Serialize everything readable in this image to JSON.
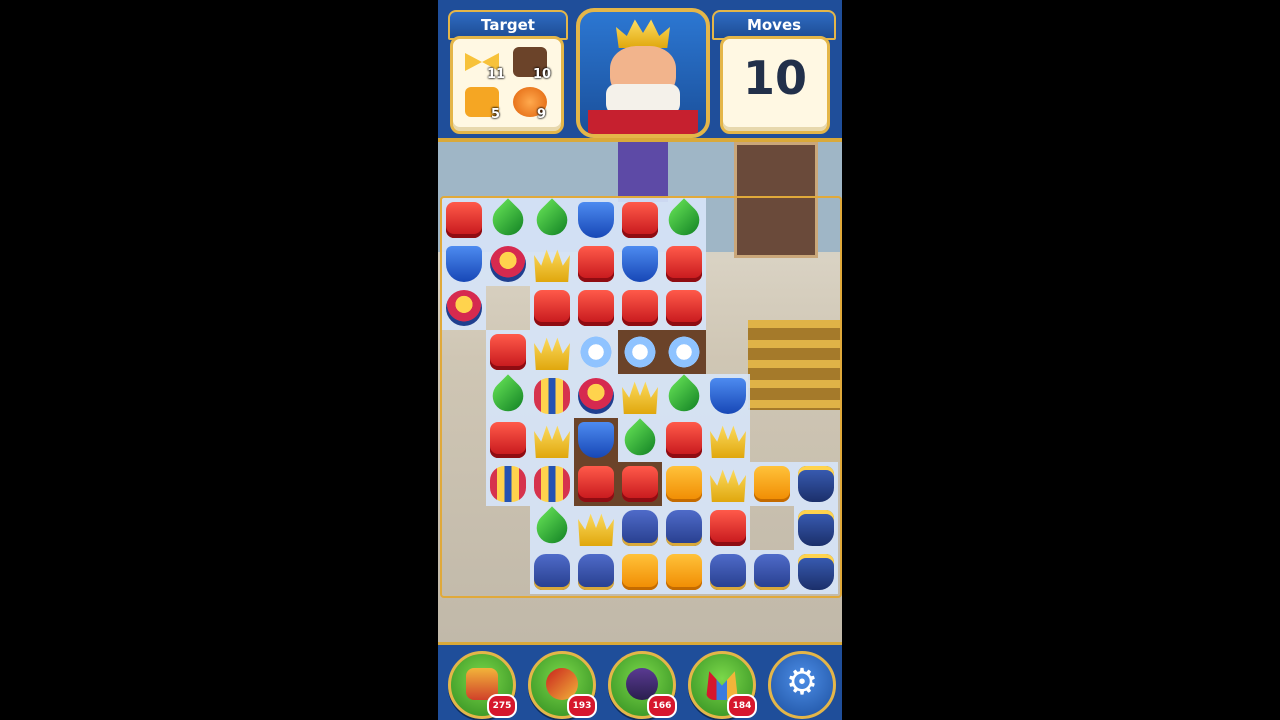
{
  "hud": {
    "target_label": "Target",
    "moves_label": "Moves",
    "moves_value": "10",
    "targets": [
      {
        "icon": "ribbon-icon",
        "count": "11",
        "color": "#f7c23a"
      },
      {
        "icon": "dirt-tile-icon",
        "count": "10",
        "color": "#6b4329"
      },
      {
        "icon": "orange-tile-icon",
        "count": "5",
        "color": "#f5a623"
      },
      {
        "icon": "pumpkin-icon",
        "count": "9",
        "color": "#f07d13"
      }
    ]
  },
  "boosters": [
    {
      "name": "hammer-icon",
      "count": "275"
    },
    {
      "name": "arrow-icon",
      "count": "193"
    },
    {
      "name": "cannon-icon",
      "count": "166"
    },
    {
      "name": "jester-hat-icon",
      "count": "184"
    }
  ],
  "settings": {
    "icon": "gear-icon"
  },
  "colors": {
    "hud_blue": "#1f4e9a",
    "gold": "#e4b649"
  }
}
